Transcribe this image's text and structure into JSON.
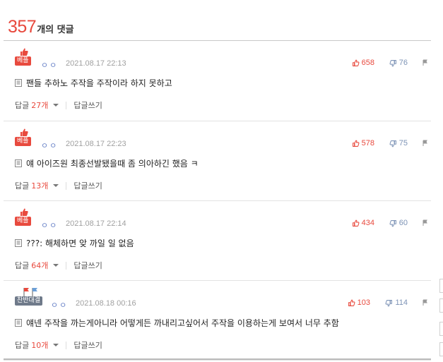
{
  "header": {
    "count": "357",
    "suffix": "개의 댓글"
  },
  "colors": {
    "accent": "#e8493d",
    "user": "#6a83c8",
    "dislike": "#7d93b6",
    "badge_gray": "#6f7a8a"
  },
  "comments": [
    {
      "badge": "베플",
      "badge_icon": "thumbs-up-icon",
      "badge_style": "red",
      "user": "ㅇㅇ",
      "date": "2021.08.17 22:13",
      "likes": "658",
      "dislikes": "76",
      "text": "팬들 추하노 주작을 주작이라 하지 못하고",
      "reply_label": "답글",
      "reply_count": "27개",
      "write_label": "답글쓰기"
    },
    {
      "badge": "베플",
      "badge_icon": "thumbs-up-icon",
      "badge_style": "red",
      "user": "ㅇㅇ",
      "date": "2021.08.17 22:23",
      "likes": "578",
      "dislikes": "75",
      "text": "얘 아이즈원 최종선발됐을때 좀 의아하긴 했음 ㅋ",
      "reply_label": "답글",
      "reply_count": "13개",
      "write_label": "답글쓰기"
    },
    {
      "badge": "베플",
      "badge_icon": "thumbs-up-icon",
      "badge_style": "red",
      "user": "ㅇㅇ",
      "date": "2021.08.17 22:14",
      "likes": "434",
      "dislikes": "60",
      "text": "???: 해체하면 앚 까일 일 없음",
      "reply_label": "답글",
      "reply_count": "64개",
      "write_label": "답글쓰기"
    },
    {
      "badge": "찬반대결",
      "badge_icon": "flags-icon",
      "badge_style": "gray",
      "user": "ㅇㅇ",
      "date": "2021.08.18 00:16",
      "likes": "103",
      "dislikes": "114",
      "text": "얘넨 주작을 까는게아니라 어떻게든 까내리고싶어서 주작을 이용하는게 보여서 너무 추함",
      "reply_label": "답글",
      "reply_count": "10개",
      "write_label": "답글쓰기"
    }
  ]
}
